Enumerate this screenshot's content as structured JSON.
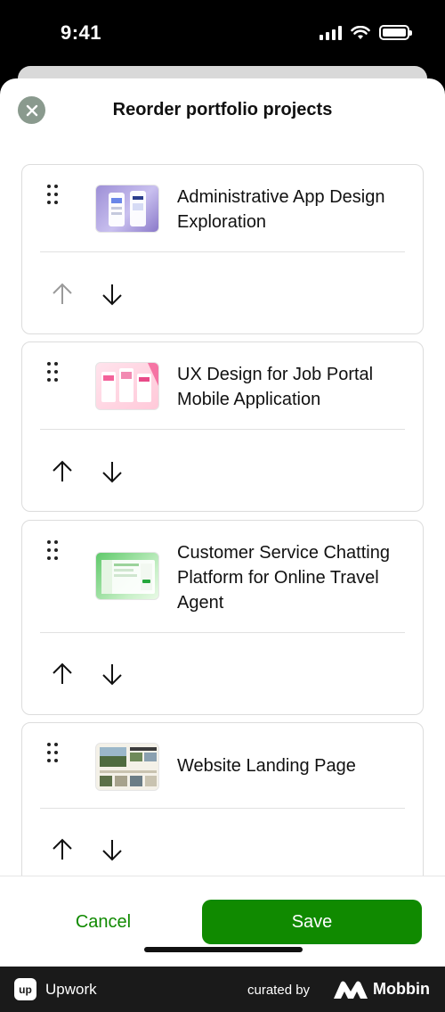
{
  "status_bar": {
    "time": "9:41"
  },
  "sheet": {
    "title": "Reorder portfolio projects"
  },
  "projects": [
    {
      "title": "Administrative App Design Exploration",
      "thumbnail": "purple-app-screens",
      "up_enabled": false,
      "down_enabled": true
    },
    {
      "title": "UX Design for Job Portal Mobile Application",
      "thumbnail": "pink-app-screens",
      "up_enabled": true,
      "down_enabled": true
    },
    {
      "title": "Customer Service Chatting Platform for Online Travel Agent",
      "thumbnail": "green-dashboard",
      "up_enabled": true,
      "down_enabled": true
    },
    {
      "title": "Website Landing Page",
      "thumbnail": "landscape-website",
      "up_enabled": true,
      "down_enabled": true
    }
  ],
  "footer": {
    "cancel_label": "Cancel",
    "save_label": "Save"
  },
  "brand_bar": {
    "app_name": "Upwork",
    "app_logo_text": "up",
    "curated_by": "curated by",
    "mobbin": "Mobbin"
  },
  "colors": {
    "accent_green": "#108a00",
    "close_button": "#8a9a8e",
    "disabled_arrow": "#9a9a9a"
  }
}
